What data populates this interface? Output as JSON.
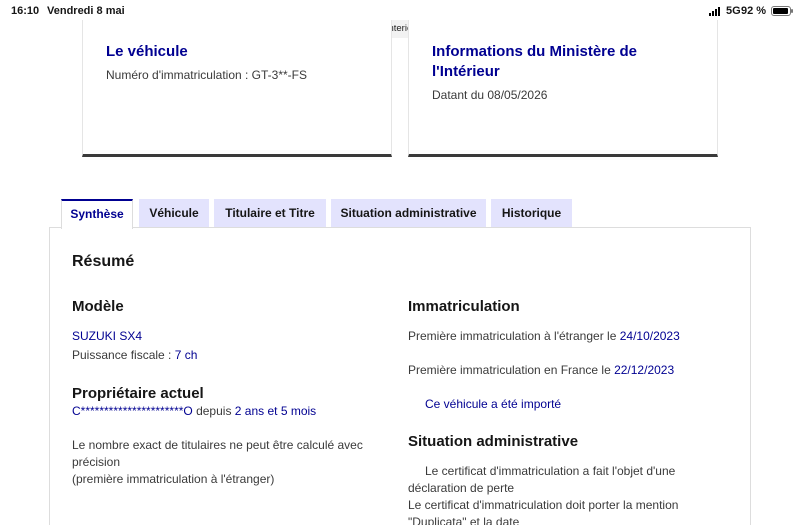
{
  "status_bar": {
    "time": "16:10",
    "date": "Vendredi 8 mai",
    "network": "5G",
    "battery": "92 %"
  },
  "browser": {
    "url": "histovec.interieur.gouv.fr"
  },
  "card_vehicle": {
    "title": "Le véhicule",
    "registration": "Numéro d'immatriculation : GT-3**-FS"
  },
  "card_ministry": {
    "title": "Informations du Ministère de l'Intérieur",
    "date": "Datant du 08/05/2026"
  },
  "tabs": [
    {
      "label": "Synthèse"
    },
    {
      "label": "Véhicule"
    },
    {
      "label": "Titulaire et Titre"
    },
    {
      "label": "Situation administrative"
    },
    {
      "label": "Historique"
    }
  ],
  "summary": {
    "title": "Résumé",
    "model": {
      "heading": "Modèle",
      "name": "SUZUKI SX4",
      "power_label": "Puissance fiscale : ",
      "power_value": "7 ch"
    },
    "owner": {
      "heading": "Propriétaire actuel",
      "masked_name": "C**********************O",
      "since_label": " depuis ",
      "since_value": "2 ans et 5 mois",
      "note_line1": "Le nombre exact de titulaires ne peut être calculé avec",
      "note_line2": "précision",
      "note_line3": "(première immatriculation à l'étranger)"
    },
    "registration": {
      "heading": "Immatriculation",
      "foreign_label": "Première immatriculation à l'étranger le ",
      "foreign_date": "24/10/2023",
      "france_label": "Première immatriculation en France le ",
      "france_date": "22/12/2023",
      "imported": "Ce véhicule a été importé"
    },
    "admin": {
      "heading": "Situation administrative",
      "line1": "Le certificat d'immatriculation a fait l'objet d'une",
      "line2": "déclaration de perte",
      "line3": "Le certificat d'immatriculation doit porter la mention",
      "line4": "\"Duplicata\" et la date"
    }
  }
}
